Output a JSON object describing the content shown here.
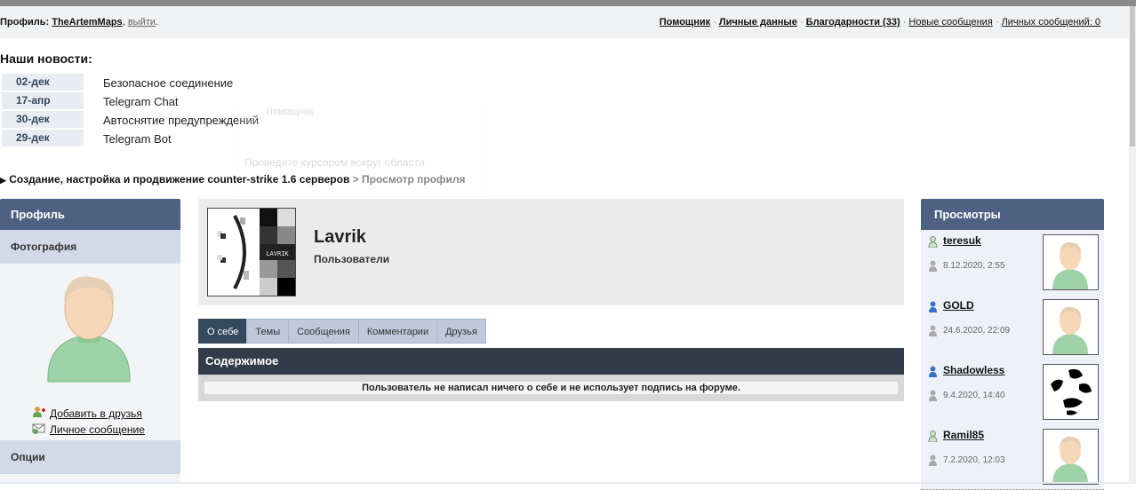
{
  "topbar": {
    "profile_label": "Профиль:",
    "username": "TheArtemMaps",
    "logout": "выйти",
    "links": [
      {
        "label": "Помощник",
        "bold": true
      },
      {
        "label": "Личные данные",
        "bold": true
      },
      {
        "label": "Благодарности (33)",
        "bold": true
      },
      {
        "label": "Новые сообщения",
        "bold": false
      },
      {
        "label": "Личных сообщений: 0",
        "bold": false
      }
    ]
  },
  "news": {
    "title": "Наши новости:",
    "items": [
      {
        "date": "02-дек",
        "text": "Безопасное соединение"
      },
      {
        "date": "17-апр",
        "text": "Telegram Chat"
      },
      {
        "date": "30-дек",
        "text": "Автоснятие предупреждений"
      },
      {
        "date": "29-дек",
        "text": "Telegram Bot"
      }
    ]
  },
  "ghost_popup": {
    "title": "Помощник",
    "text": "Проведите курсором вокруг области."
  },
  "breadcrumb": {
    "forum": "Создание, настройка и продвижение counter-strike 1.6 серверов",
    "separator": ">",
    "current": "Просмотр профиля"
  },
  "sidebar": {
    "title": "Профиль",
    "photo_label": "Фотография",
    "add_friend": "Добавить в друзья",
    "private_message": "Личное сообщение",
    "options_label": "Опции"
  },
  "profile": {
    "name": "Lavrik",
    "group": "Пользователи",
    "avatar_text": "LAVRIK"
  },
  "tabs": [
    "О себе",
    "Темы",
    "Сообщения",
    "Комментарии",
    "Друзья"
  ],
  "content": {
    "title": "Содержимое",
    "message": "Пользователь не написал ничего о себе и не использует подпись на форуме."
  },
  "views": {
    "title": "Просмотры",
    "items": [
      {
        "name": "teresuk",
        "time": "8.12.2020, 2:55",
        "online": false
      },
      {
        "name": "GOLD",
        "time": "24.6.2020, 22:09",
        "online": true
      },
      {
        "name": "Shadowless",
        "time": "9.4.2020, 14:40",
        "online": true
      },
      {
        "name": "Ramil85",
        "time": "7.2.2020, 12:03",
        "online": false
      }
    ]
  },
  "colors": {
    "header_blue": "#4e6183",
    "subheader": "#d2dae8",
    "content_head": "#323b48",
    "tab_active": "#34495e",
    "tab_inactive": "#bfc9db"
  }
}
